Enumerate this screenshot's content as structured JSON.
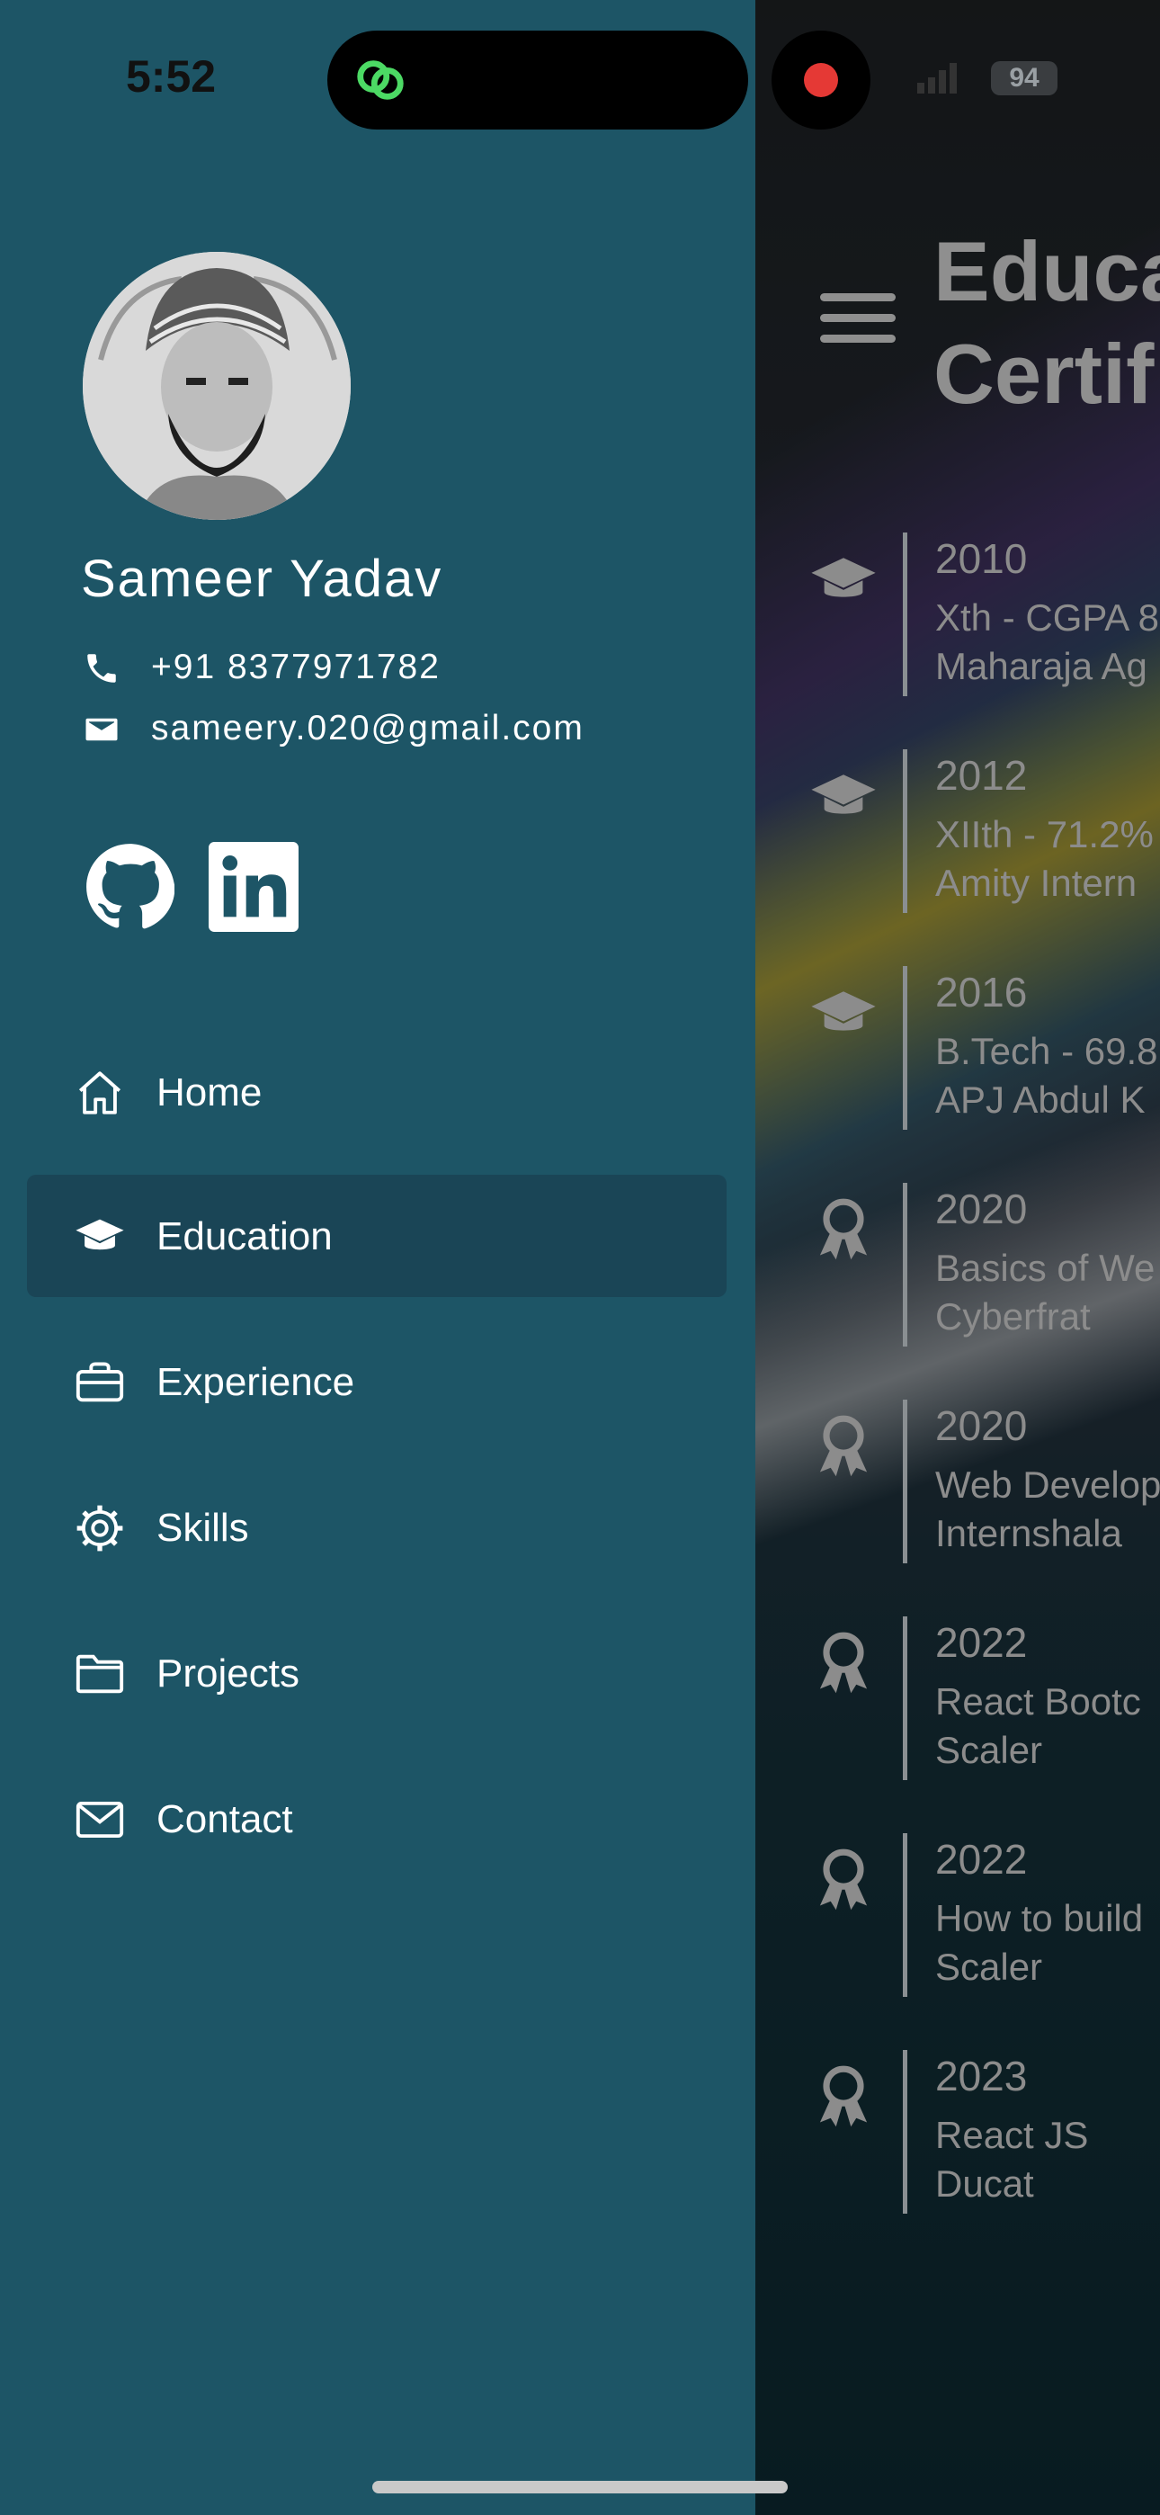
{
  "status_bar": {
    "time": "5:52",
    "battery": "94"
  },
  "background_page": {
    "title_line1": "Educa",
    "title_line2": "Certif",
    "timeline": [
      {
        "icon": "graduation-cap-icon",
        "year": "2010",
        "line1": "Xth - CGPA 8",
        "line2": "Maharaja Ag"
      },
      {
        "icon": "graduation-cap-icon",
        "year": "2012",
        "line1": "XIIth - 71.2%",
        "line2": "Amity Intern"
      },
      {
        "icon": "graduation-cap-icon",
        "year": "2016",
        "line1": "B.Tech - 69.8",
        "line2": "APJ Abdul K"
      },
      {
        "icon": "award-icon",
        "year": "2020",
        "line1": "Basics of We",
        "line2": "Cyberfrat"
      },
      {
        "icon": "award-icon",
        "year": "2020",
        "line1": "Web Develop",
        "line2": "Internshala"
      },
      {
        "icon": "award-icon",
        "year": "2022",
        "line1": "React Bootc",
        "line2": "Scaler"
      },
      {
        "icon": "award-icon",
        "year": "2022",
        "line1": "How to build",
        "line2": "Scaler"
      },
      {
        "icon": "award-icon",
        "year": "2023",
        "line1": "React JS",
        "line2": "Ducat"
      }
    ]
  },
  "drawer": {
    "name": "Sameer Yadav",
    "phone": "+91 8377971782",
    "email": "sameery.020@gmail.com",
    "social": [
      "github-icon",
      "linkedin-icon"
    ],
    "nav": [
      {
        "label": "Home",
        "icon": "home-icon",
        "active": false
      },
      {
        "label": "Education",
        "icon": "graduation-cap-icon",
        "active": true
      },
      {
        "label": "Experience",
        "icon": "briefcase-icon",
        "active": false
      },
      {
        "label": "Skills",
        "icon": "gear-icon",
        "active": false
      },
      {
        "label": "Projects",
        "icon": "folder-icon",
        "active": false
      },
      {
        "label": "Contact",
        "icon": "envelope-icon",
        "active": false
      }
    ]
  },
  "colors": {
    "drawer_bg": "#1d5566",
    "active_nav_bg": "#1a4556",
    "text": "#ffffff",
    "recording": "#e53935",
    "island_icon": "#4cd964"
  }
}
